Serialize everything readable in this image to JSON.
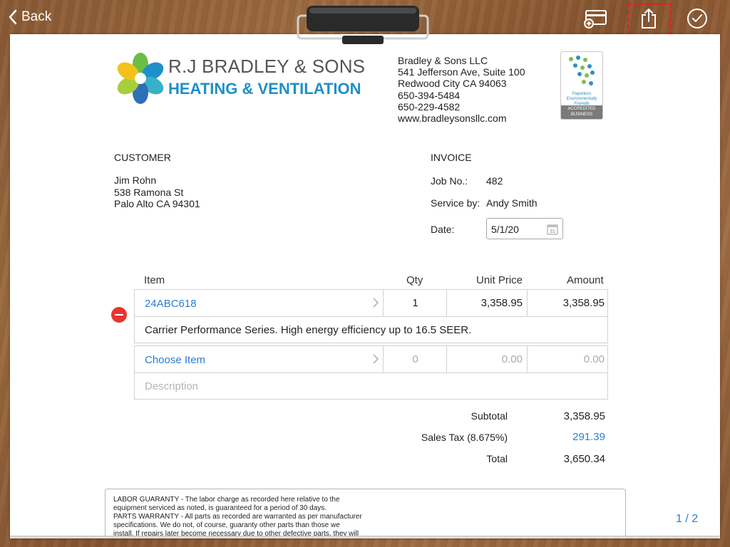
{
  "nav": {
    "back_label": "Back"
  },
  "company": {
    "brand_name": "R.J BRADLEY & SONS",
    "brand_sub": "HEATING & VENTILATION",
    "lines": [
      "Bradley & Sons LLC",
      "541 Jefferson Ave, Suite 100",
      "Redwood City CA 94063",
      "650-394-5484",
      "650-229-4582",
      "www.bradleysonsllc.com"
    ],
    "badge_text": [
      "Paperless",
      "Environmentally",
      "Friendly"
    ],
    "badge_footer": [
      "ACCREDITED",
      "BUSINESS"
    ]
  },
  "customer": {
    "heading": "CUSTOMER",
    "name": "Jim Rohn",
    "street": "538 Ramona St",
    "city": "Palo Alto CA 94301"
  },
  "invoice": {
    "heading": "INVOICE",
    "job_label": "Job No.:",
    "job_value": "482",
    "service_label": "Service by:",
    "service_value": "Andy Smith",
    "date_label": "Date:",
    "date_value": "5/1/20",
    "calendar_day": "31"
  },
  "table": {
    "headers": {
      "item": "Item",
      "qty": "Qty",
      "unit_price": "Unit Price",
      "amount": "Amount"
    },
    "rows": [
      {
        "item": "24ABC618",
        "qty": "1",
        "unit_price": "3,358.95",
        "amount": "3,358.95",
        "description": "Carrier Performance Series. High energy efficiency up to 16.5 SEER."
      },
      {
        "item": "Choose Item",
        "qty": "0",
        "unit_price": "0.00",
        "amount": "0.00",
        "description": "Description"
      }
    ]
  },
  "totals": {
    "subtotal_label": "Subtotal",
    "subtotal_value": "3,358.95",
    "tax_label": "Sales Tax (8.675%)",
    "tax_value": "291.39",
    "total_label": "Total",
    "total_value": "3,650.34"
  },
  "terms": {
    "lines": [
      "LABOR GUARANTY - The labor charge as recorded here relative to the",
      "equipment serviced as noted, is guaranteed for a period of 30 days.",
      "PARTS WARRANTY - All parts as recorded are warranted as per manufacturer",
      "specifications. We do not, of course, guaranty other parts than those we",
      "install. If repairs later become necessary due to other defective parts, they will"
    ]
  },
  "pager": {
    "label": "1 / 2"
  },
  "colors": {
    "accent": "#2a7fd4",
    "delete": "#e8342f",
    "brand_blue": "#1f8fc9"
  },
  "icons": {
    "back": "chevron-left-icon",
    "card": "credit-card-add-icon",
    "share": "share-icon",
    "done": "checkmark-circle-icon",
    "calendar": "calendar-icon",
    "row_chevron": "chevron-right-icon",
    "delete": "minus-circle-icon"
  }
}
